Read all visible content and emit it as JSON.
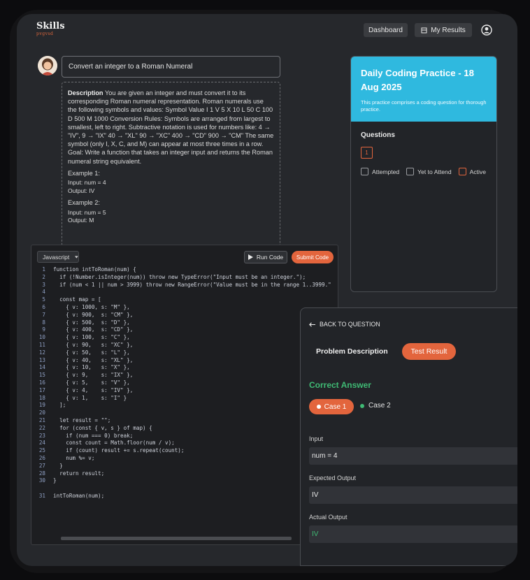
{
  "app": {
    "logo_text": "Skills",
    "logo_sub": "pvgvsd"
  },
  "nav": {
    "dashboard": "Dashboard",
    "my_results": "My Results"
  },
  "problem": {
    "title": "Convert an integer to a Roman Numeral",
    "description_label": "Description",
    "description": "You are given an integer and must convert it to its corresponding Roman numeral representation. Roman numerals use the following symbols and values: Symbol Value I 1 V 5 X 10 L 50 C 100 D 500 M 1000 Conversion Rules: Symbols are arranged from largest to smallest, left to right. Subtractive notation is used for numbers like: 4 → \"IV\", 9 → \"IX\" 40 → \"XL\" 90 → \"XC\" 400 → \"CD\" 900 → \"CM\" The same symbol (only I, X, C, and M) can appear at most three times in a row. Goal: Write a function that takes an integer input and returns the Roman numeral string equivalent.",
    "examples": [
      {
        "heading": "Example 1:",
        "input": "Input: num = 4",
        "output": "Output: IV"
      },
      {
        "heading": "Example 2:",
        "input": "Input: num = 5",
        "output": "Output: M"
      }
    ]
  },
  "editor": {
    "language": "Javascript",
    "run_label": "Run Code",
    "submit_label": "Submit Code",
    "lines": [
      {
        "n": "1",
        "code": "function intToRoman(num) {"
      },
      {
        "n": "2",
        "code": "  if (!Number.isInteger(num)) throw new TypeError(\"Input must be an integer.\");"
      },
      {
        "n": "3",
        "code": "  if (num < 1 || num > 3999) throw new RangeError(\"Value must be in the range 1..3999.\""
      },
      {
        "n": "4",
        "code": ""
      },
      {
        "n": "5",
        "code": "  const map = ["
      },
      {
        "n": "6",
        "code": "    { v: 1000, s: \"M\" },"
      },
      {
        "n": "7",
        "code": "    { v: 900,  s: \"CM\" },"
      },
      {
        "n": "8",
        "code": "    { v: 500,  s: \"D\" },"
      },
      {
        "n": "9",
        "code": "    { v: 400,  s: \"CD\" },"
      },
      {
        "n": "10",
        "code": "    { v: 100,  s: \"C\" },"
      },
      {
        "n": "11",
        "code": "    { v: 90,   s: \"XC\" },"
      },
      {
        "n": "12",
        "code": "    { v: 50,   s: \"L\" },"
      },
      {
        "n": "13",
        "code": "    { v: 40,   s: \"XL\" },"
      },
      {
        "n": "14",
        "code": "    { v: 10,   s: \"X\" },"
      },
      {
        "n": "15",
        "code": "    { v: 9,    s: \"IX\" },"
      },
      {
        "n": "16",
        "code": "    { v: 5,    s: \"V\" },"
      },
      {
        "n": "17",
        "code": "    { v: 4,    s: \"IV\" },"
      },
      {
        "n": "18",
        "code": "    { v: 1,    s: \"I\" }"
      },
      {
        "n": "19",
        "code": "  ];"
      },
      {
        "n": "20",
        "code": ""
      },
      {
        "n": "21",
        "code": "  let result = \"\";"
      },
      {
        "n": "22",
        "code": "  for (const { v, s } of map) {"
      },
      {
        "n": "23",
        "code": "    if (num === 0) break;"
      },
      {
        "n": "24",
        "code": "    const count = Math.floor(num / v);"
      },
      {
        "n": "25",
        "code": "    if (count) result += s.repeat(count);"
      },
      {
        "n": "26",
        "code": "    num %= v;"
      },
      {
        "n": "27",
        "code": "  }"
      },
      {
        "n": "28",
        "code": "  return result;"
      },
      {
        "n": "30",
        "code": "}"
      },
      {
        "n": "",
        "code": ""
      },
      {
        "n": "31",
        "code": "intToRoman(num);"
      }
    ]
  },
  "practice": {
    "title": "Daily Coding Practice - 18 Aug 2025",
    "subtitle": "This practice comprises a coding question for thorough practice.",
    "questions_label": "Questions",
    "question_number": "1",
    "legend": [
      "Attempted",
      "Yet to Attend",
      "Active"
    ]
  },
  "result": {
    "back_label": "BACK TO QUESTION",
    "tab_description": "Problem Description",
    "tab_result": "Test Result",
    "status": "Correct Answer",
    "case1": "Case 1",
    "case2": "Case 2",
    "input_label": "Input",
    "input_value": "num = 4",
    "expected_label": "Expected Output",
    "expected_value": "IV",
    "actual_label": "Actual Output",
    "actual_value": "IV"
  },
  "colors": {
    "accent": "#e3653d",
    "header": "#2fb9df",
    "success": "#3fba74"
  }
}
